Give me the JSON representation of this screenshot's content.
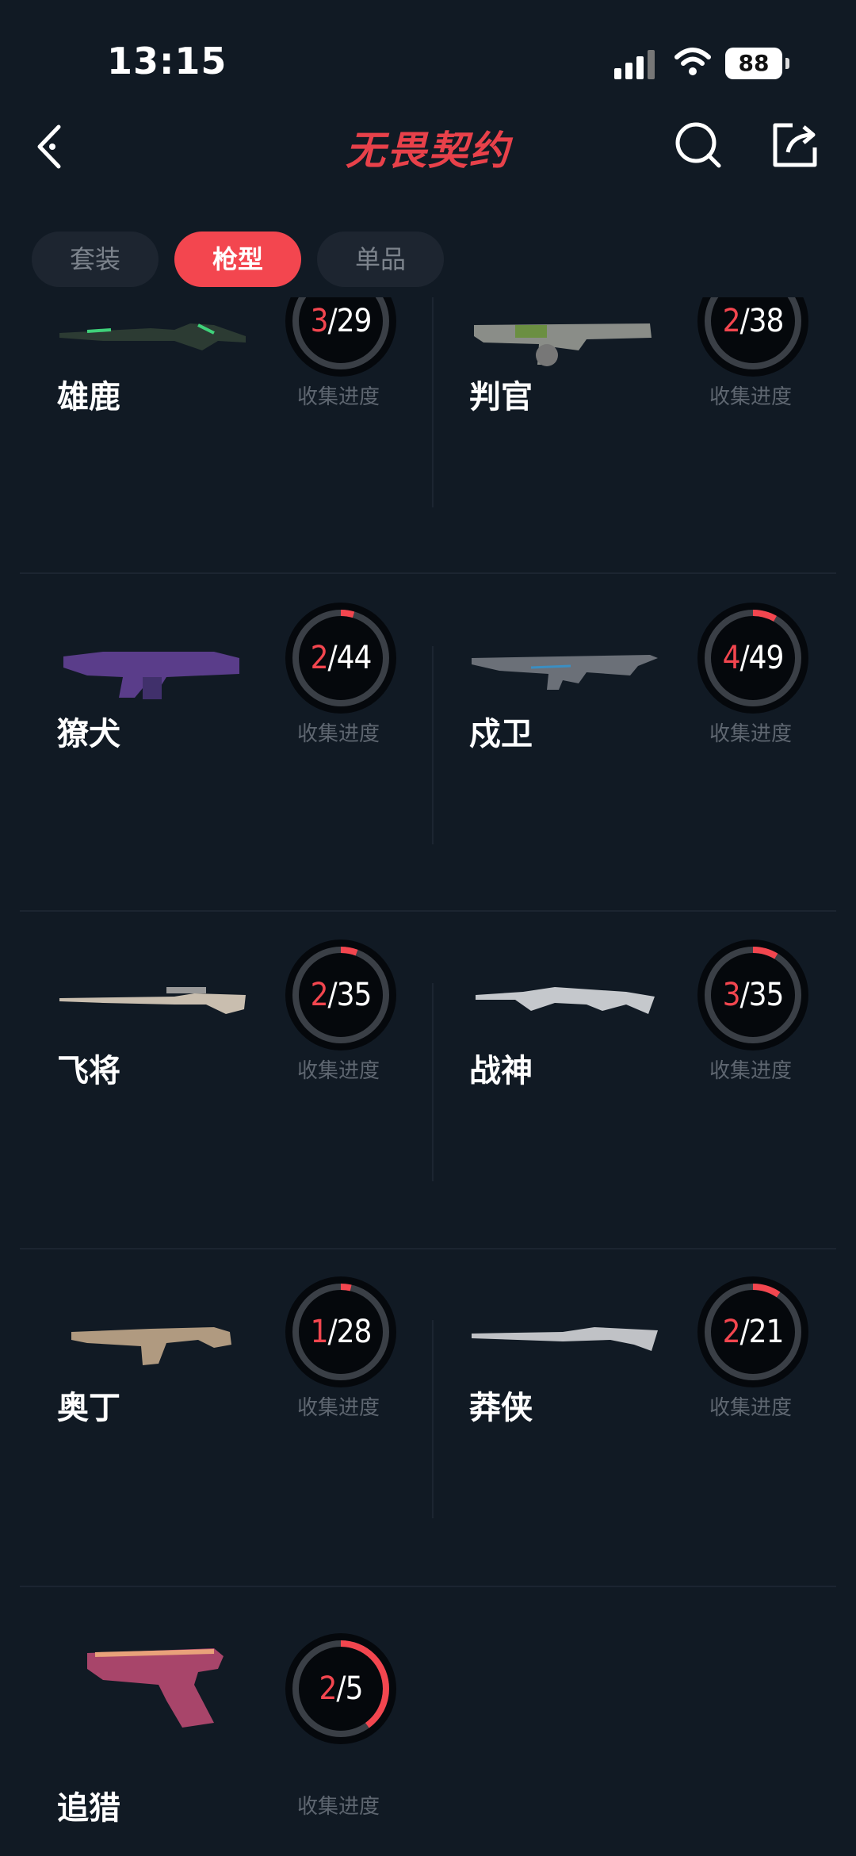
{
  "status": {
    "time": "13:15",
    "battery": "88"
  },
  "header": {
    "title": "无畏契约"
  },
  "tabs": [
    {
      "label": "套装",
      "active": false
    },
    {
      "label": "枪型",
      "active": true
    },
    {
      "label": "单品",
      "active": false
    }
  ],
  "progress_label": "收集进度",
  "weapons": [
    {
      "name": "雄鹿",
      "collected": "3",
      "total": "29",
      "icon": "shotgun-icon"
    },
    {
      "name": "判官",
      "collected": "2",
      "total": "38",
      "icon": "auto-shotgun-icon"
    },
    {
      "name": "獠犬",
      "collected": "2",
      "total": "44",
      "icon": "smg-icon"
    },
    {
      "name": "戍卫",
      "collected": "4",
      "total": "49",
      "icon": "rifle-icon"
    },
    {
      "name": "飞将",
      "collected": "2",
      "total": "35",
      "icon": "sniper-icon"
    },
    {
      "name": "战神",
      "collected": "3",
      "total": "35",
      "icon": "machine-gun-icon"
    },
    {
      "name": "奥丁",
      "collected": "1",
      "total": "28",
      "icon": "heavy-mg-icon"
    },
    {
      "name": "莽侠",
      "collected": "2",
      "total": "21",
      "icon": "marshal-icon"
    },
    {
      "name": "追猎",
      "collected": "2",
      "total": "5",
      "icon": "pistol-icon"
    }
  ],
  "colors": {
    "accent": "#f3464f",
    "background": "#111a24",
    "ring_track": "#3a3f46"
  }
}
